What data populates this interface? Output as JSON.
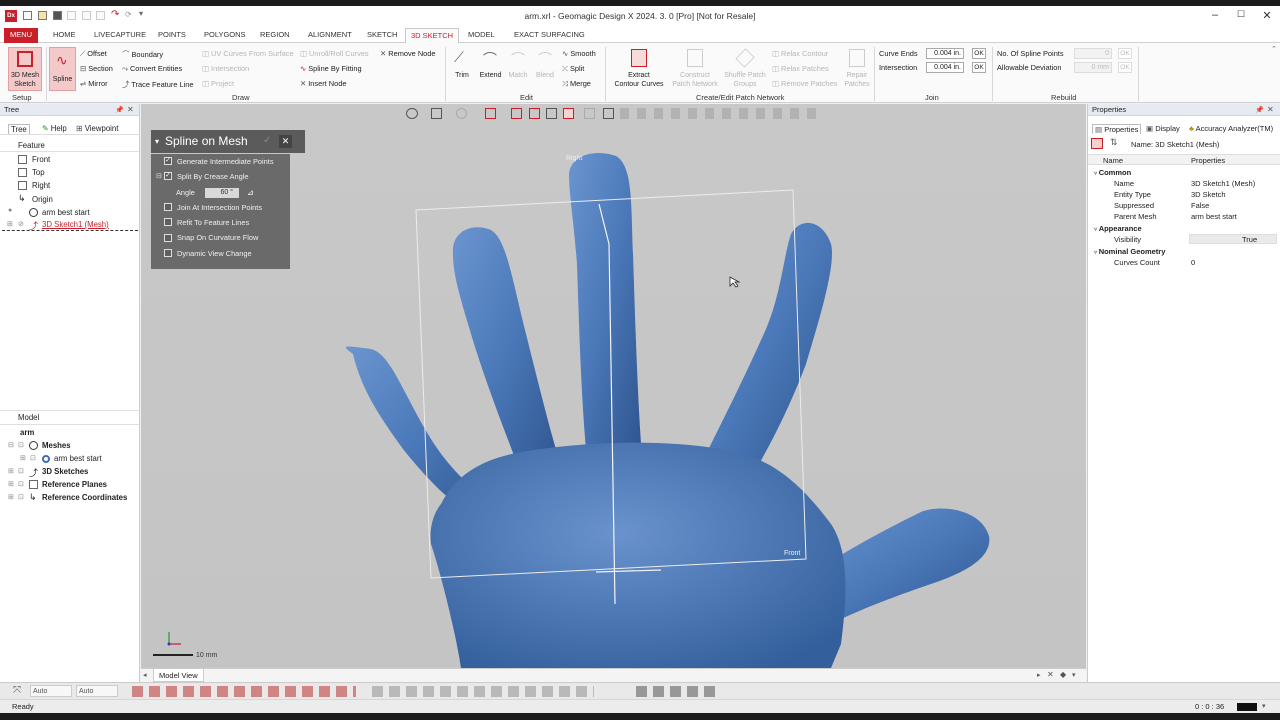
{
  "window": {
    "title": "arm.xrl - Geomagic Design X 2024. 3. 0 [Pro] [Not for Resale]",
    "app_icon": "Dx"
  },
  "tabs": [
    "MENU",
    "HOME",
    "LIVECAPTURE",
    "POINTS",
    "POLYGONS",
    "REGION",
    "ALIGNMENT",
    "SKETCH",
    "3D SKETCH",
    "MODEL",
    "EXACT SURFACING"
  ],
  "active_tab": "3D SKETCH",
  "ribbon": {
    "setup": {
      "btn_line1": "3D Mesh",
      "btn_line2": "Sketch",
      "group": "Setup"
    },
    "draw": {
      "spline": "Spline",
      "offset": "Offset",
      "section": "Section",
      "mirror": "Mirror",
      "boundary": "Boundary",
      "convert_entities": "Convert Entities",
      "trace_feature_line": "Trace Feature Line",
      "uv_curves": "UV Curves From Surface",
      "intersection": "Intersection",
      "project": "Project",
      "unroll": "Unroll/Roll Curves",
      "spline_by_fitting": "Spline By Fitting",
      "insert_node": "Insert Node",
      "remove_node": "Remove Node",
      "group": "Draw"
    },
    "edit": {
      "trim": "Trim",
      "extend": "Extend",
      "match": "Match",
      "blend": "Blend",
      "smooth": "Smooth",
      "split": "Split",
      "merge": "Merge",
      "group": "Edit"
    },
    "patch": {
      "extract_line1": "Extract",
      "extract_line2": "Contour Curves",
      "construct_line1": "Construct",
      "construct_line2": "Patch Network",
      "shuffle_line1": "Shuffle Patch",
      "shuffle_line2": "Groups",
      "relax_contour": "Relax Contour",
      "relax_patches": "Relax Patches",
      "remove_patches": "Remove Patches",
      "repair_line1": "Repair",
      "repair_line2": "Patches",
      "group": "Create/Edit Patch Network"
    },
    "join": {
      "curve_ends": "Curve Ends",
      "curve_ends_val": "0.004 in.",
      "intersection": "Intersection",
      "intersection_val": "0.004 in.",
      "ok": "OK",
      "group": "Join"
    },
    "rebuild": {
      "num_spline_points": "No. Of Spline Points",
      "num_val": "0",
      "allowable_dev": "Allowable Deviation",
      "dev_val": "0 mm",
      "ok": "OK",
      "group": "Rebuild"
    }
  },
  "tree_panel": {
    "header": "Tree",
    "tabs": [
      "Tree",
      "Help",
      "Viewpoint"
    ],
    "feature_label": "Feature",
    "features": [
      "Front",
      "Top",
      "Right",
      "Origin",
      "arm best start",
      "3D Sketch1 (Mesh)"
    ],
    "model_label": "Model",
    "model_root": "arm",
    "model_items": [
      "Meshes",
      "arm best start",
      "3D Sketches",
      "Reference Planes",
      "Reference Coordinates"
    ]
  },
  "spline_panel": {
    "title": "Spline on Mesh",
    "options": [
      {
        "label": "Generate Intermediate Points",
        "checked": true
      },
      {
        "label": "Split By Crease Angle",
        "checked": true
      },
      {
        "label": "Join At Intersection Points",
        "checked": false
      },
      {
        "label": "Refit To Feature Lines",
        "checked": false
      },
      {
        "label": "Snap On Curvature Flow",
        "checked": false
      },
      {
        "label": "Dynamic View Change",
        "checked": false
      }
    ],
    "angle_label": "Angle",
    "angle_value": "60 °"
  },
  "viewport": {
    "plane_right": "Right",
    "plane_front": "Front",
    "scale_label": "10 mm",
    "model_color": "#4a78b8"
  },
  "properties": {
    "header": "Properties",
    "tabs": [
      "Properties",
      "Display",
      "Accuracy Analyzer(TM)"
    ],
    "name_line": "Name: 3D Sketch1 (Mesh)",
    "col_name": "Name",
    "col_props": "Properties",
    "common": "Common",
    "rows": [
      {
        "k": "Name",
        "v": "3D Sketch1 (Mesh)"
      },
      {
        "k": "Entity Type",
        "v": "3D Sketch"
      },
      {
        "k": "Suppressed",
        "v": "False"
      },
      {
        "k": "Parent Mesh",
        "v": "arm best start"
      }
    ],
    "appearance": "Appearance",
    "visibility_k": "Visibility",
    "visibility_v": "True",
    "nominal": "Nominal Geometry",
    "curves_count_k": "Curves Count",
    "curves_count_v": "0"
  },
  "bottom": {
    "model_view_tab": "Model View",
    "auto1": "Auto",
    "auto2": "Auto"
  },
  "status": {
    "ready": "Ready",
    "time": "0 : 0 : 36"
  }
}
